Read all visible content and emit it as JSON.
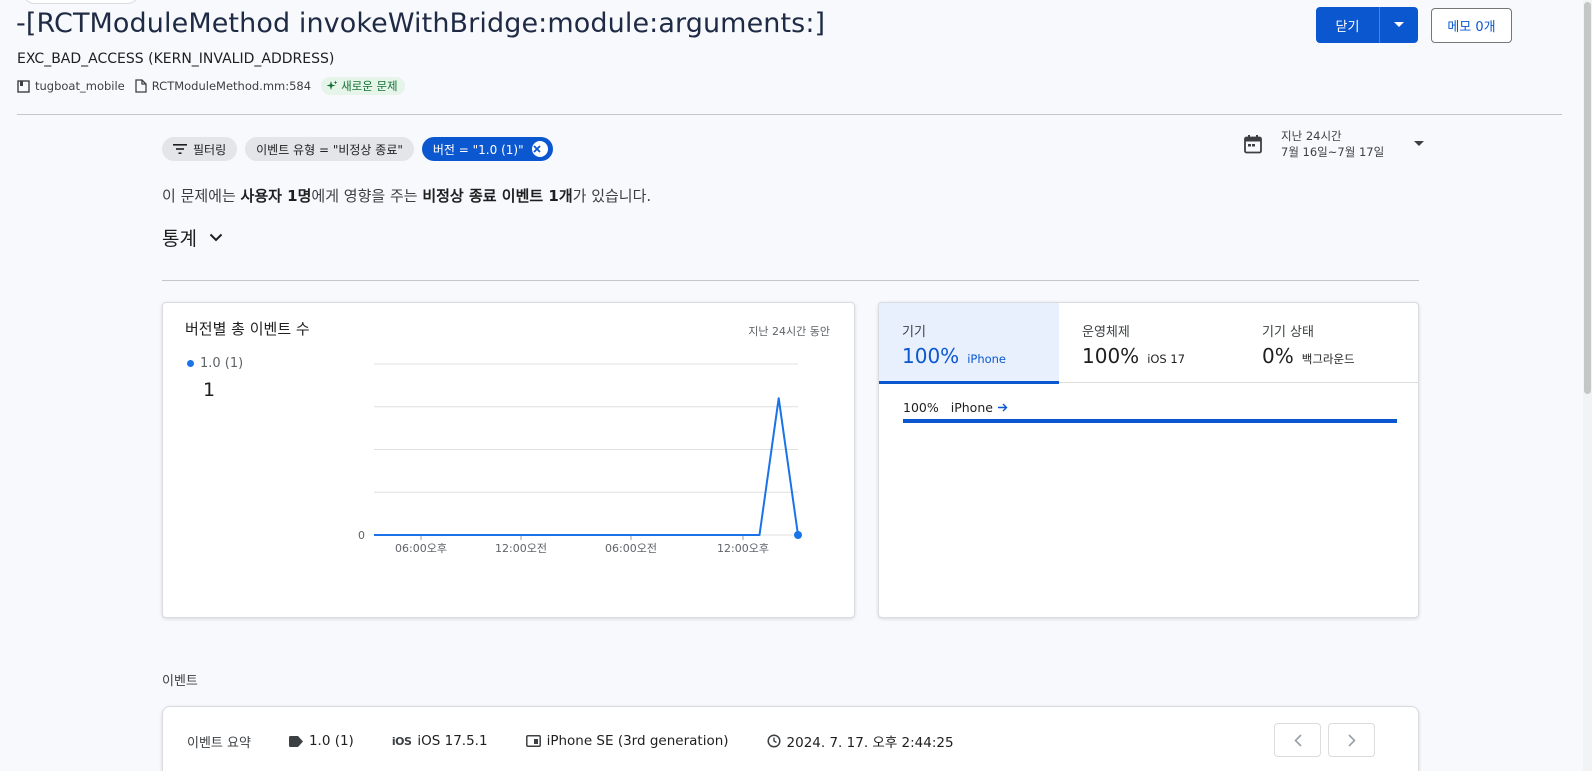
{
  "issue": {
    "title": "-[RCTModuleMethod invokeWithBridge:module:arguments:]",
    "subtitle": "EXC_BAD_ACCESS (KERN_INVALID_ADDRESS)",
    "app": "tugboat_mobile",
    "file": "RCTModuleMethod.mm:584",
    "badge": "새로운 문제"
  },
  "actions": {
    "close_label": "닫기",
    "memo_label": "메모 0개"
  },
  "filters": [
    {
      "label": "필터링"
    },
    {
      "label": "이벤트 유형 = \"비정상 종료\""
    },
    {
      "label": "버전 = \"1.0 (1)\"",
      "active": true
    }
  ],
  "date_range": {
    "line1": "지난 24시간",
    "line2": "7월 16일~7월 17일"
  },
  "summary": {
    "p1": "이 문제에는 ",
    "b1": "사용자 1명",
    "p2": "에게 영향을 주는 ",
    "b2": "비정상 종료 이벤트 1개",
    "p3": "가 있습니다."
  },
  "stats": {
    "title": "통계"
  },
  "chart_card": {
    "title": "버전별 총 이벤트 수",
    "period": "지난 24시간 동안",
    "legend_label": "1.0 (1)",
    "legend_value": "1"
  },
  "chart_data": {
    "type": "line",
    "x_tick_labels": [
      "06:00오후",
      "12:00오전",
      "06:00오전",
      "12:00오후"
    ],
    "y_tick_labels": [
      "0"
    ],
    "series": [
      {
        "name": "1.0 (1)",
        "color": "#1a73e8",
        "values": [
          0,
          0,
          0,
          0,
          0,
          0,
          0,
          0,
          0,
          0,
          0,
          0,
          0,
          0,
          0,
          0,
          0,
          0,
          0,
          0,
          0,
          1,
          0
        ]
      }
    ],
    "ylim": [
      0,
      1.25
    ],
    "grid": true
  },
  "distribution": {
    "tabs": [
      {
        "label": "기기",
        "pct": "100%",
        "name": "iPhone",
        "selected": true
      },
      {
        "label": "운영체제",
        "pct": "100%",
        "name": "iOS 17"
      },
      {
        "label": "기기 상태",
        "pct": "0%",
        "name": "백그라운드"
      }
    ],
    "rows": [
      {
        "pct": "100%",
        "name": "iPhone",
        "share": 1.0
      }
    ]
  },
  "events": {
    "section_label": "이벤트",
    "summary_label": "이벤트 요약",
    "version": "1.0 (1)",
    "os_icon": "iOS",
    "os": "iOS 17.5.1",
    "device": "iPhone SE (3rd generation)",
    "time": "2024. 7. 17. 오후 2:44:25"
  },
  "colors": {
    "primary": "#0b57d0",
    "series": "#1a73e8",
    "badge_bg": "#e6f4ea",
    "badge_text": "#137333"
  }
}
